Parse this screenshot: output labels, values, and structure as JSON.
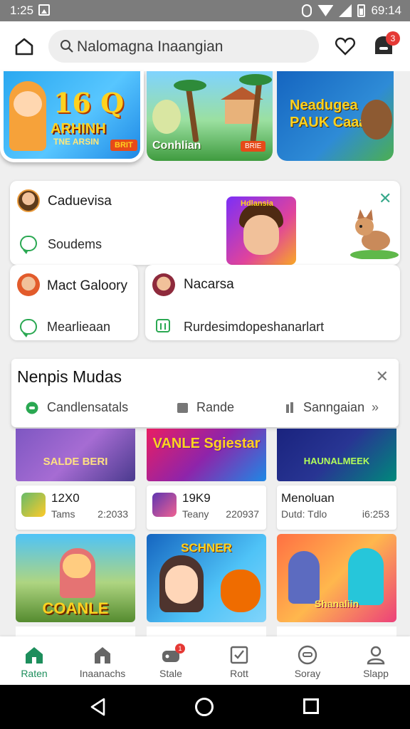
{
  "status": {
    "time": "1:25",
    "clock": "69:14"
  },
  "header": {
    "search_text": "Nalomagna Inaangian",
    "notification_count": "3"
  },
  "hero": [
    {
      "title": "16 Q",
      "subtitle": "ARHINH",
      "tagline": "TNE ARSIN",
      "badge": "BRIT"
    },
    {
      "title": "Conhlian",
      "badge": "BRIE"
    },
    {
      "title": "Neadugea PAUK Caaas"
    }
  ],
  "cards": {
    "big": {
      "title": "Caduevisa",
      "subtitle": "Soudems",
      "portrait_tag": "Hdlansia"
    },
    "left": {
      "title": "Mact Galoory",
      "subtitle": "Mearlieaan"
    },
    "right": {
      "title": "Nacarsa",
      "subtitle": "Rurdesimdopeshanarlart"
    }
  },
  "section": {
    "title": "Nenpis Mudas",
    "filters": [
      "Candlensatals",
      "Rande",
      "Sanngaian"
    ]
  },
  "games": [
    {
      "banner": "SALDE BERI",
      "title": "12X0",
      "sub": "Tams",
      "num": "2:2033"
    },
    {
      "banner": "VANLE Sgiestar",
      "title": "19K9",
      "sub": "Teany",
      "num": "220937"
    },
    {
      "banner": "HAUNALMEEK",
      "title": "Menoluan",
      "sub": "Dutd: Tdlo",
      "num": "i6:253"
    }
  ],
  "large_tiles": [
    {
      "label": "COANLE"
    },
    {
      "label": "SCHNER"
    },
    {
      "label": "Shanaliin"
    }
  ],
  "bottom_nav": [
    {
      "label": "Raten",
      "icon": "home-icon"
    },
    {
      "label": "Inaanachs",
      "icon": "store-icon"
    },
    {
      "label": "Stale",
      "icon": "gamepad-icon",
      "badge": "1"
    },
    {
      "label": "Rott",
      "icon": "checkbox-icon"
    },
    {
      "label": "Soray",
      "icon": "circle-menu-icon"
    },
    {
      "label": "Slapp",
      "icon": "person-icon"
    }
  ],
  "colors": {
    "accent": "#1d8e5c",
    "badge": "#e53935",
    "chat": "#2aa852"
  }
}
